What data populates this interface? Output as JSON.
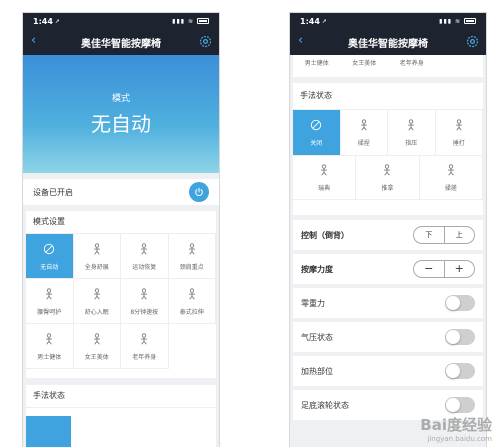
{
  "status_bar": {
    "time": "1:44",
    "arrow": "➚",
    "signal": "signal-icon wifi-icon battery-icon"
  },
  "app": {
    "title": "奥佳华智能按摩椅"
  },
  "hero": {
    "mode_label": "模式",
    "mode_value": "无自动"
  },
  "device": {
    "status": "设备已开启"
  },
  "modes": {
    "title": "模式设置",
    "items": [
      {
        "label": "无自动",
        "icon": "slash-icon",
        "active": true
      },
      {
        "label": "全身舒展",
        "icon": "stretch-icon"
      },
      {
        "label": "运动恢复",
        "icon": "weight-icon"
      },
      {
        "label": "颈肩重点",
        "icon": "shoulder-icon"
      },
      {
        "label": "腰臀呵护",
        "icon": "waist-icon"
      },
      {
        "label": "舒心入眠",
        "icon": "sleep-icon"
      },
      {
        "label": "8分钟速按",
        "icon": "timer-icon"
      },
      {
        "label": "泰式拉伸",
        "icon": "thai-stretch-icon"
      },
      {
        "label": "男士健体",
        "icon": "man-icon"
      },
      {
        "label": "女王美体",
        "icon": "queen-icon"
      },
      {
        "label": "老年养身",
        "icon": "elder-icon"
      }
    ]
  },
  "technique": {
    "title": "手法状态",
    "items": [
      {
        "label": "关闭",
        "icon": "slash-icon",
        "active": true
      },
      {
        "label": "揉捏",
        "icon": "knead-icon"
      },
      {
        "label": "指压",
        "icon": "press-icon"
      },
      {
        "label": "捶打",
        "icon": "tap-icon"
      },
      {
        "label": "瑞典",
        "icon": "swedish-icon"
      },
      {
        "label": "推拿",
        "icon": "tuina-icon"
      },
      {
        "label": "揉搓",
        "icon": "rub-icon"
      }
    ]
  },
  "controls": {
    "backrest": {
      "label": "控制（倒背）",
      "down": "下",
      "up": "上"
    },
    "strength": {
      "label": "按摩力度",
      "minus": "−",
      "plus": "+"
    },
    "toggles": [
      "零重力",
      "气压状态",
      "加热部位",
      "足底滚轮状态"
    ]
  },
  "right_top_partial": [
    "男士健体",
    "女王美体",
    "老年养身"
  ],
  "watermark": {
    "text": "Bai度经验",
    "sub": "jingyan.baidu.com"
  },
  "colors": {
    "nav": "#1e2330",
    "accent": "#3fa3e0",
    "toggle_off": "#cfcfcf"
  }
}
